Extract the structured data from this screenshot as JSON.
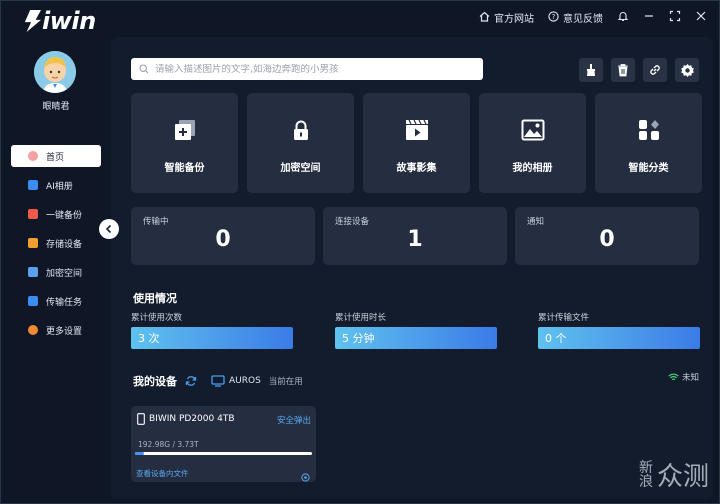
{
  "app": {
    "logo": "Biwin",
    "official_site": "官方网站",
    "feedback": "意见反馈"
  },
  "user": {
    "name": "眼睛君"
  },
  "nav": [
    {
      "label": "首页",
      "icon": "home-icon",
      "color": "#f07a7a",
      "active": true
    },
    {
      "label": "AI相册",
      "icon": "ai-album-icon",
      "color": "#3a8cf0",
      "active": false
    },
    {
      "label": "一键备份",
      "icon": "backup-icon",
      "color": "#f05a4a",
      "active": false
    },
    {
      "label": "存储设备",
      "icon": "storage-icon",
      "color": "#f0a030",
      "active": false
    },
    {
      "label": "加密空间",
      "icon": "lock-folder-icon",
      "color": "#5aa0f0",
      "active": false
    },
    {
      "label": "传输任务",
      "icon": "transfer-icon",
      "color": "#3a8cf0",
      "active": false
    },
    {
      "label": "更多设置",
      "icon": "settings-icon",
      "color": "#f08a30",
      "active": false
    }
  ],
  "search": {
    "placeholder": "请输入描述图片的文字,如海边奔跑的小男孩"
  },
  "features": [
    {
      "label": "智能备份",
      "icon": "smart-backup-icon"
    },
    {
      "label": "加密空间",
      "icon": "lock-icon"
    },
    {
      "label": "故事影集",
      "icon": "clapper-icon"
    },
    {
      "label": "我的相册",
      "icon": "photo-icon"
    },
    {
      "label": "智能分类",
      "icon": "category-icon"
    }
  ],
  "stats": [
    {
      "label": "传输中",
      "value": "0"
    },
    {
      "label": "连接设备",
      "value": "1"
    },
    {
      "label": "通知",
      "value": "0"
    }
  ],
  "usage": {
    "title": "使用情况",
    "items": [
      {
        "label": "累计使用次数",
        "value": "3 次"
      },
      {
        "label": "累计使用时长",
        "value": "5 分钟"
      },
      {
        "label": "累计传输文件",
        "value": "0 个"
      }
    ]
  },
  "devices": {
    "title": "我的设备",
    "computer_name": "AUROS",
    "computer_status": "当前在用",
    "wifi_status": "未知",
    "list": [
      {
        "name": "BIWIN PD2000 4TB",
        "eject": "安全弹出",
        "capacity": "192.98G / 3.73T",
        "used_fraction": 0.05,
        "link": "查看设备内文件"
      }
    ]
  },
  "watermark": {
    "big": "众测",
    "small1": "新",
    "small2": "浪"
  }
}
